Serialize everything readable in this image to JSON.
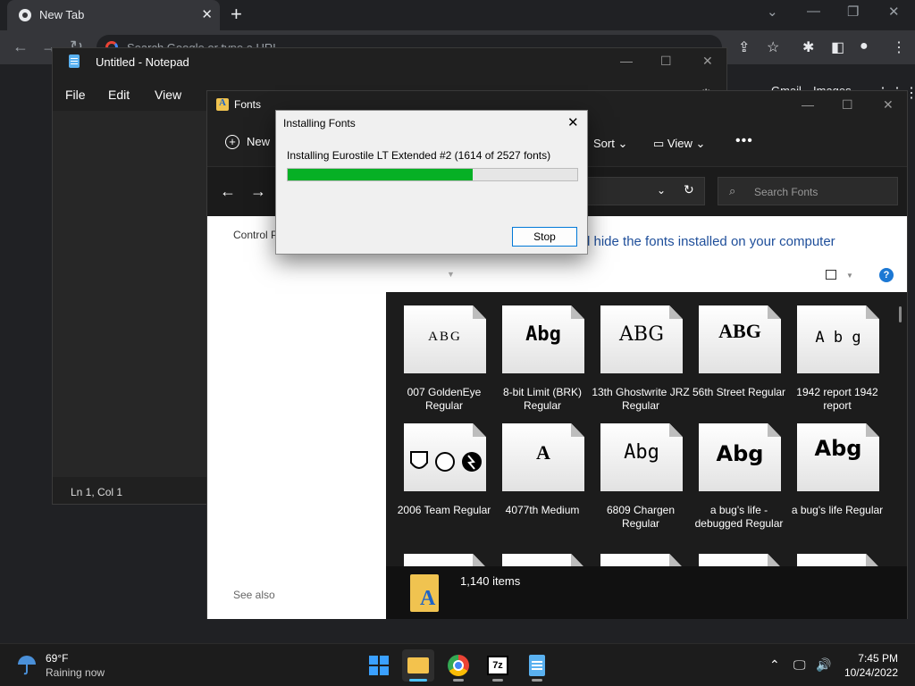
{
  "chrome": {
    "tab_title": "New Tab",
    "tab_close": "✕",
    "new_tab": "+",
    "omnibox_placeholder": "Search Google or type a URL",
    "gmail": "Gmail",
    "images": "Images"
  },
  "notepad": {
    "title": "Untitled - Notepad",
    "menu": [
      "File",
      "Edit",
      "View"
    ],
    "status_position": "Ln 1, Col 1"
  },
  "fonts_window": {
    "title": "Fonts",
    "cmd_new": "New",
    "cmd_sort": "Sort",
    "cmd_view": "View",
    "search_placeholder": "Search Fonts",
    "sidebar_label": "Control P",
    "sidebar_see_also": "See also",
    "headline": "d hide the fonts installed on your computer",
    "items_count": "1,140 items",
    "fonts": [
      {
        "preview": "ABG",
        "name": "007 GoldenEye Regular"
      },
      {
        "preview": "Abg",
        "name": "8-bit Limit (BRK) Regular"
      },
      {
        "preview": "ABG",
        "name": "13th Ghostwrite JRZ Regular"
      },
      {
        "preview": "ABG",
        "name": "56th Street Regular"
      },
      {
        "preview": "A b g",
        "name": "1942 report 1942 report"
      },
      {
        "preview": "",
        "name": "2006 Team Regular"
      },
      {
        "preview": "A",
        "name": "4077th Medium"
      },
      {
        "preview": "Abg",
        "name": "6809 Chargen Regular"
      },
      {
        "preview": "Abg",
        "name": "a bug's life - debugged Regular"
      },
      {
        "preview": "Abg",
        "name": "a bug's life Regular"
      }
    ]
  },
  "install_dialog": {
    "title": "Installing Fonts",
    "message": "Installing Eurostile LT Extended #2 (1614 of 2527 fonts)",
    "progress": 0.6387,
    "stop_label": "Stop"
  },
  "taskbar": {
    "weather_temp": "69°F",
    "weather_desc": "Raining now",
    "time": "7:45 PM",
    "date": "10/24/2022",
    "apps": [
      "start-icon",
      "file-explorer-icon",
      "chrome-icon",
      "7zip-icon",
      "notepad-icon"
    ]
  },
  "colors": {
    "progress_fill": "#06b025",
    "headline_link": "#1e4e9a",
    "accent": "#0078d7"
  }
}
